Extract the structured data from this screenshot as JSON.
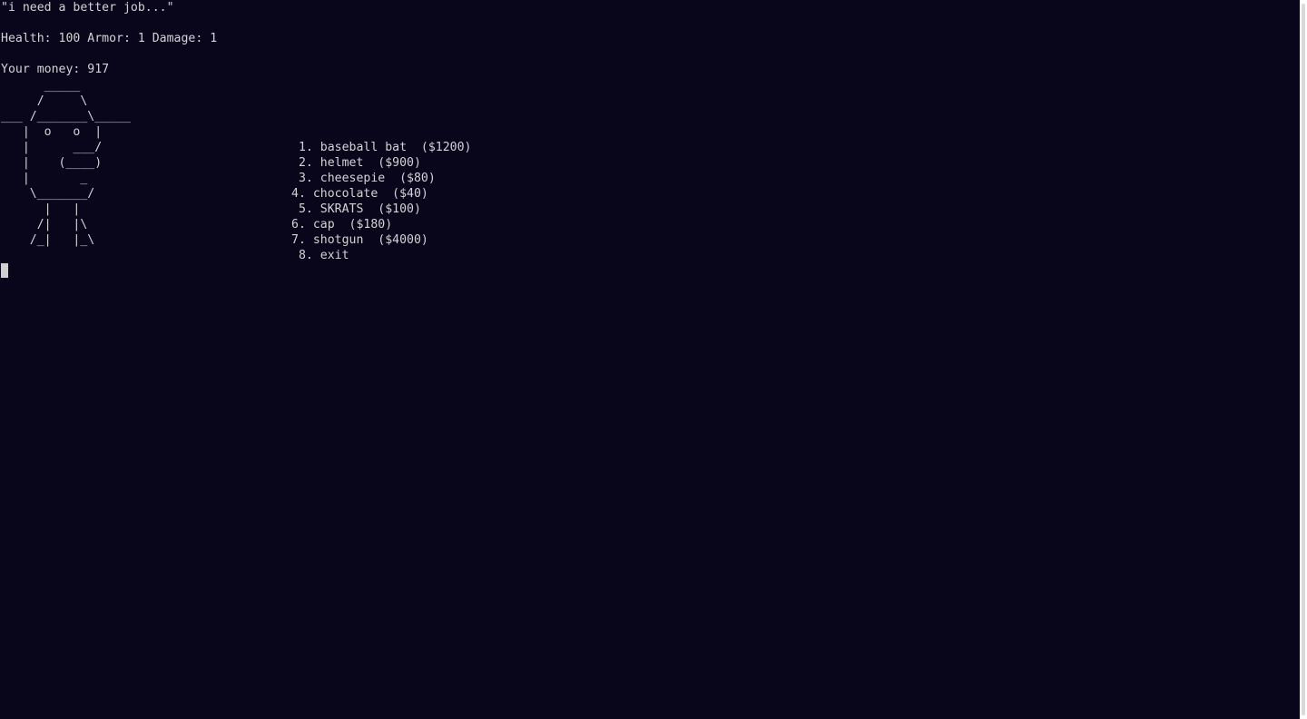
{
  "terminal": {
    "quote": "\"i need a better job...\"",
    "stats": "Health: 100 Armor: 1 Damage: 1",
    "money": "Your money: 917",
    "art": [
      "      _____",
      "     /     \\",
      "___ /_______\\_____",
      "   |  o   o  |",
      "   |      ___/",
      "   |    (____)",
      "   |       _",
      "    \\_______/",
      "      |   |",
      "     /|   |\\",
      "    /_|   |_\\"
    ],
    "menu": [
      " 1. baseball bat  ($1200)",
      " 2. helmet  ($900)",
      " 3. cheesepie  ($80)",
      "4. chocolate  ($40)",
      " 5. SKRATS  ($100)",
      "6. cap  ($180)",
      "7. shotgun  ($4000)",
      " 8. exit"
    ]
  }
}
